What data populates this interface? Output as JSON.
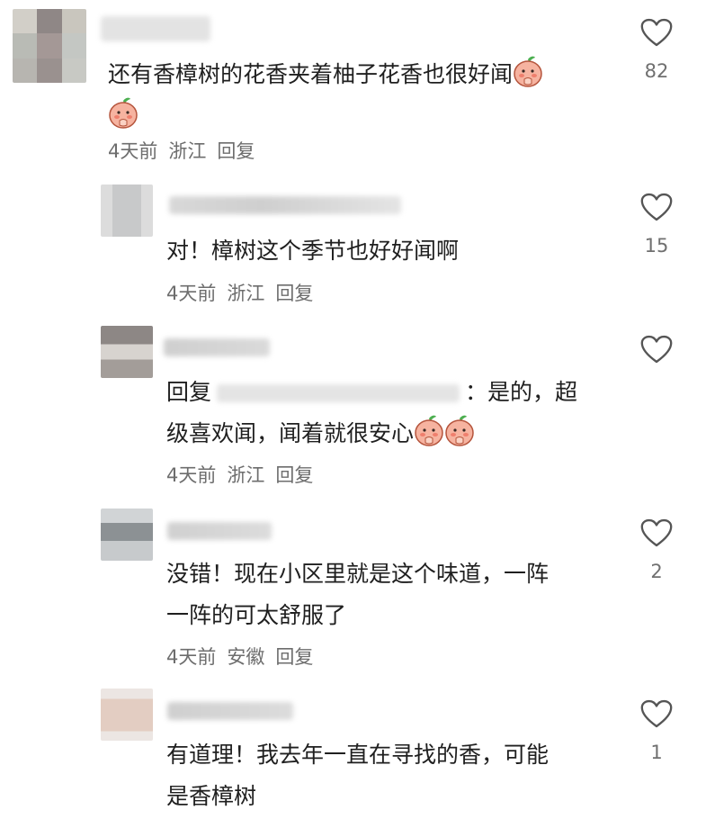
{
  "comments": [
    {
      "text": "还有香樟树的花香夹着柚子花香也很好闻",
      "time": "4天前",
      "location": "浙江",
      "reply_label": "回复",
      "likes": "82"
    },
    {
      "text": "对！樟树这个季节也好好闻啊",
      "time": "4天前",
      "location": "浙江",
      "reply_label": "回复",
      "likes": "15"
    },
    {
      "prefix": "回复",
      "text_after_name": "：是的，超",
      "text_line2": "级喜欢闻，闻着就很安心",
      "time": "4天前",
      "location": "浙江",
      "reply_label": "回复",
      "likes": ""
    },
    {
      "text_line1": "没错！现在小区里就是这个味道，一阵",
      "text_line2": "一阵的可太舒服了",
      "time": "4天前",
      "location": "安徽",
      "reply_label": "回复",
      "likes": "2"
    },
    {
      "text_line1": "有道理！我去年一直在寻找的香，可能",
      "text_line2": "是香樟树",
      "time": "",
      "location": "",
      "reply_label": "",
      "likes": "1"
    }
  ],
  "icons": {
    "like": "heart-outline-icon",
    "emoji": "peach-face-emoji"
  },
  "colors": {
    "text": "#1f1f1f",
    "meta": "#6d6d6d",
    "heart": "#555555",
    "emoji": "#f3a38f"
  }
}
